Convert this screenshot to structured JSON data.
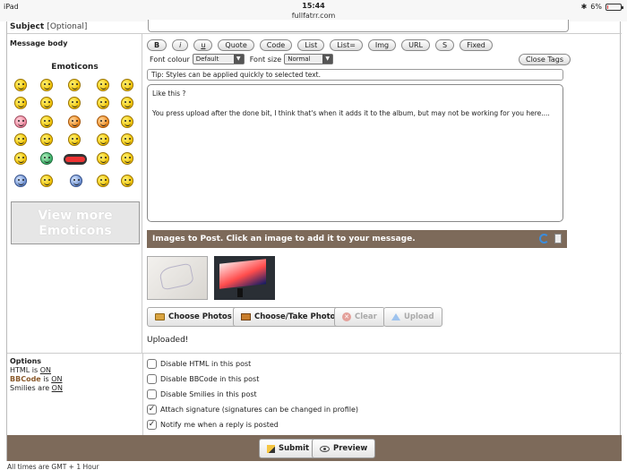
{
  "statusbar": {
    "device": "iPad",
    "time": "15:44",
    "url": "fullfatrr.com",
    "battery": "6%",
    "battery_level": 0.06
  },
  "subject": {
    "label": "Subject",
    "hint": "[Optional]"
  },
  "message_body": {
    "label": "Message body"
  },
  "emoticons": {
    "title": "Emoticons",
    "view_more": "View more Emoticons"
  },
  "toolbar": {
    "buttons": [
      "B",
      "i",
      "u",
      "Quote",
      "Code",
      "List",
      "List=",
      "Img",
      "URL",
      "S",
      "Fixed"
    ],
    "font_colour_label": "Font colour",
    "font_colour_value": "Default",
    "font_size_label": "Font size",
    "font_size_value": "Normal",
    "close_tags": "Close Tags"
  },
  "tip": "Tip: Styles can be applied quickly to selected text.",
  "message": {
    "line1": "Like this ?",
    "line2": "You press upload after the done bit, I think that's when it adds it to the album, but may not be working for you here...."
  },
  "images": {
    "header": "Images to Post. Click an image to add it to your message.",
    "choose_photos": "Choose Photos",
    "choose_take_photo": "Choose/Take Photo",
    "clear": "Clear",
    "upload": "Upload",
    "status": "Uploaded!"
  },
  "options": {
    "title": "Options",
    "html_label": "HTML is",
    "html_value": "ON",
    "bbcode_label": "BBCode",
    "bbcode_mid": "is",
    "bbcode_value": "ON",
    "smilies_label": "Smilies are",
    "smilies_value": "ON",
    "checkboxes": [
      {
        "label": "Disable HTML in this post",
        "checked": false
      },
      {
        "label": "Disable BBCode in this post",
        "checked": false
      },
      {
        "label": "Disable Smilies in this post",
        "checked": false
      },
      {
        "label": "Attach signature (signatures can be changed in profile)",
        "checked": true
      },
      {
        "label": "Notify me when a reply is posted",
        "checked": true
      }
    ]
  },
  "actions": {
    "submit": "Submit",
    "preview": "Preview"
  },
  "timezone": "All times are GMT + 1 Hour"
}
